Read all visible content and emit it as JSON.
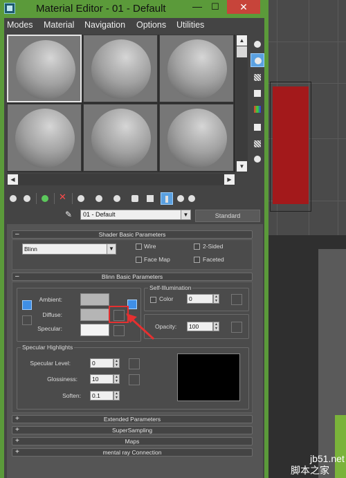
{
  "window": {
    "title": "Material Editor - 01 - Default",
    "minimize": "—",
    "maximize": "☐",
    "close": "✕"
  },
  "menu": [
    "Modes",
    "Material",
    "Navigation",
    "Options",
    "Utilities"
  ],
  "scroll": {
    "up": "▲",
    "down": "▼",
    "left": "◀",
    "right": "▶"
  },
  "material": {
    "name": "01 - Default",
    "type": "Standard"
  },
  "rollouts": {
    "shader_basic": {
      "title": "Shader Basic Parameters",
      "toggle": "–",
      "shader": "Blinn",
      "options": {
        "wire": "Wire",
        "two_sided": "2-Sided",
        "face_map": "Face Map",
        "faceted": "Faceted"
      }
    },
    "blinn_basic": {
      "title": "Blinn Basic Parameters",
      "toggle": "–",
      "ambient": "Ambient:",
      "diffuse": "Diffuse:",
      "specular": "Specular:",
      "self_illum_title": "Self-Illumination",
      "color_label": "Color",
      "color_value": "0",
      "opacity_label": "Opacity:",
      "opacity_value": "100",
      "highlights_title": "Specular Highlights",
      "specular_level_label": "Specular Level:",
      "specular_level_value": "0",
      "glossiness_label": "Glossiness:",
      "glossiness_value": "10",
      "soften_label": "Soften:",
      "soften_value": "0.1"
    },
    "collapsed": [
      {
        "sign": "+",
        "title": "Extended Parameters"
      },
      {
        "sign": "+",
        "title": "SuperSampling"
      },
      {
        "sign": "+",
        "title": "Maps"
      },
      {
        "sign": "+",
        "title": "mental ray Connection"
      }
    ]
  },
  "colors": {
    "window_frame": "#5b9a3a",
    "close_button": "#c7443a",
    "active_toggle": "#3f8fe6",
    "highlight_marker": "#e53030",
    "viewport_object": "#a3191b"
  },
  "watermark": {
    "line1": "jb51.net",
    "line2": "脚本之家"
  }
}
